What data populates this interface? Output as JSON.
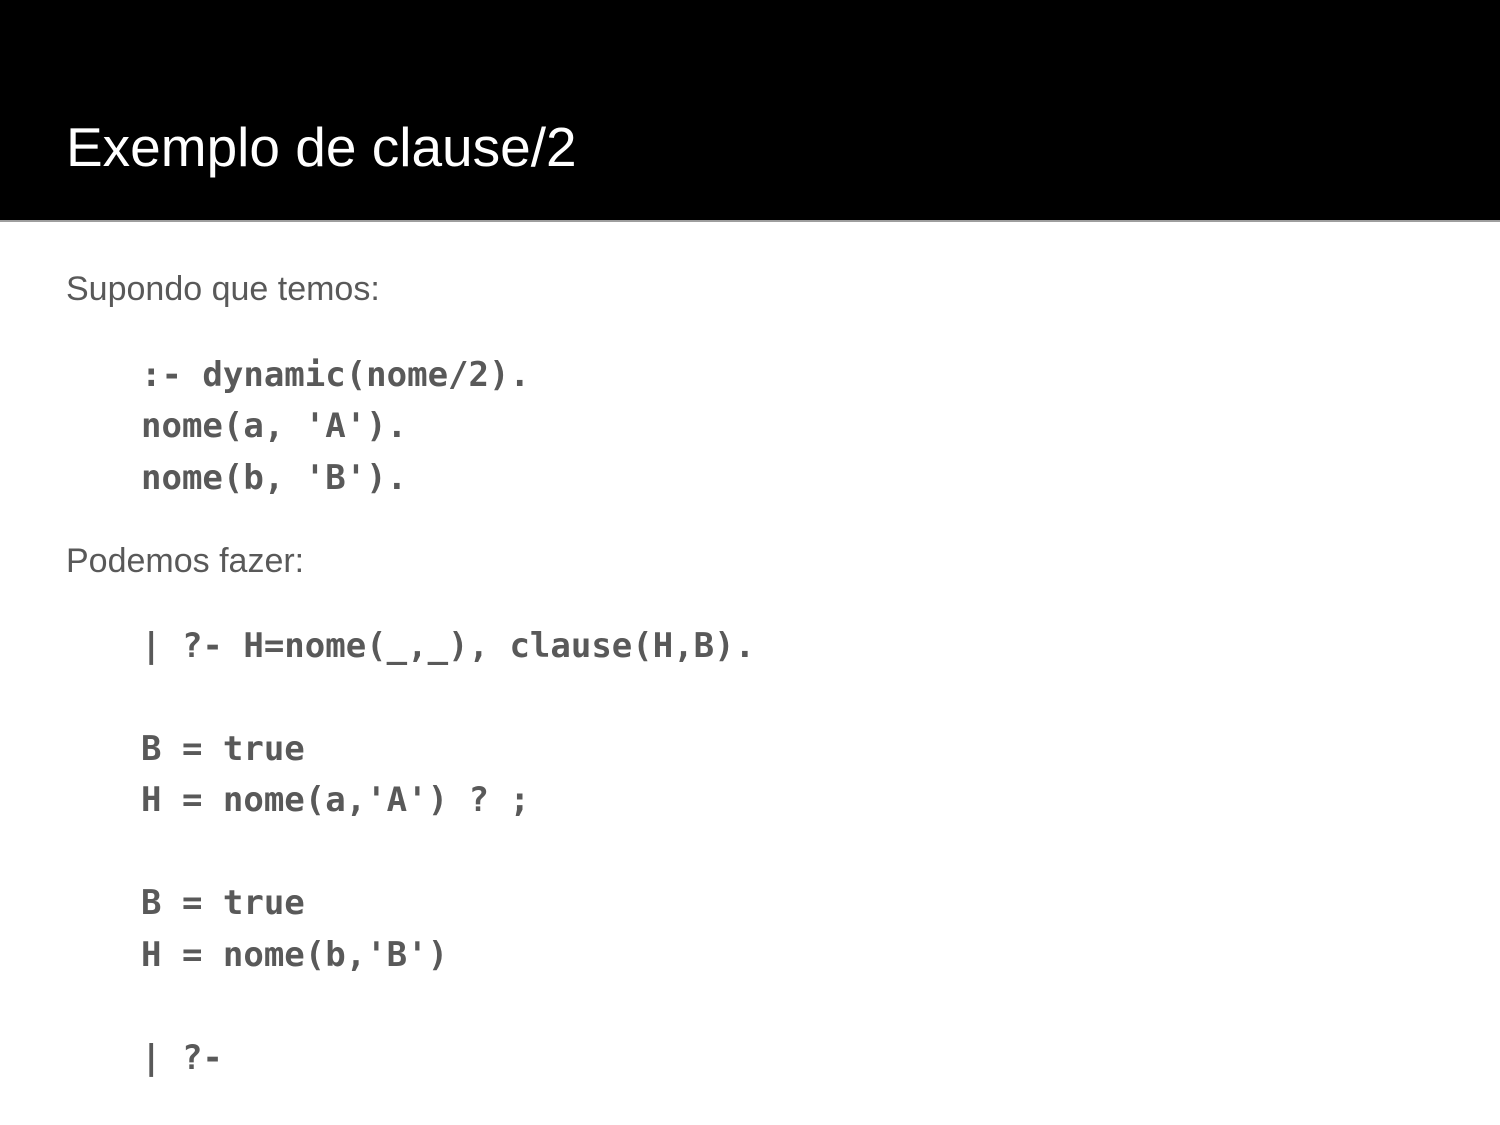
{
  "slide": {
    "title": "Exemplo de clause/2"
  },
  "intro_text": "Supondo que temos:",
  "facts_code": [
    ":- dynamic(nome/2).",
    "nome(a, 'A').",
    "nome(b, 'B')."
  ],
  "query_text": "Podemos fazer:",
  "query_session": [
    "| ?- H=nome(_,_), clause(H,B).",
    "",
    "B = true",
    "H = nome(a,'A') ? ;",
    "",
    "B = true",
    "H = nome(b,'B')",
    "",
    "| ?-"
  ]
}
